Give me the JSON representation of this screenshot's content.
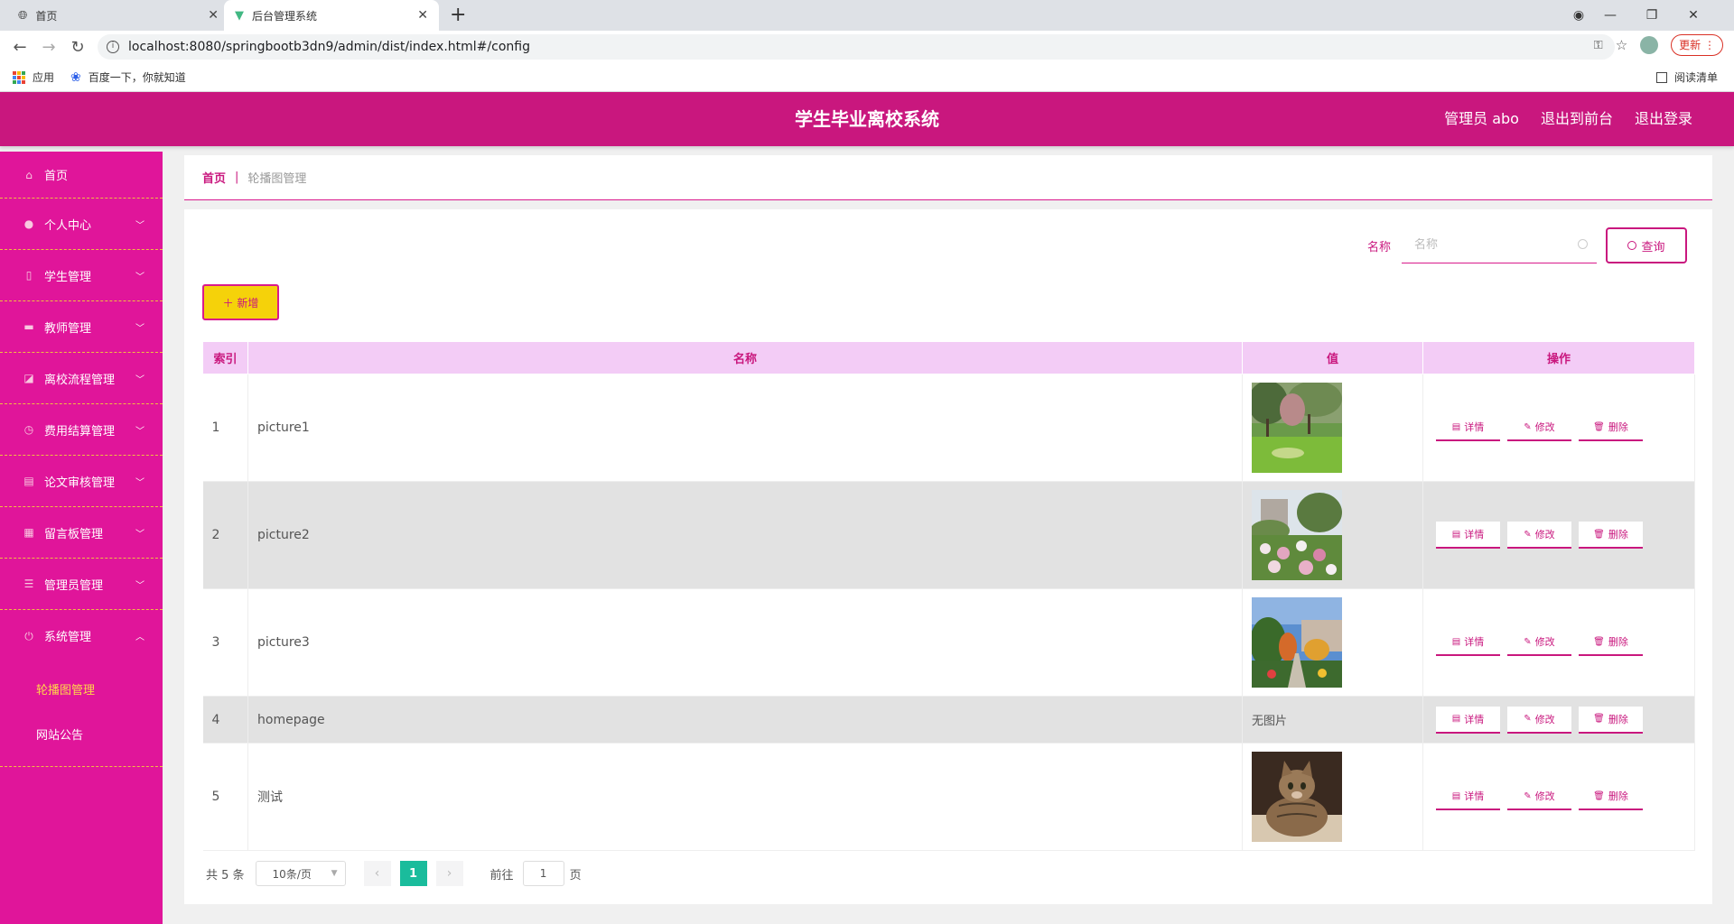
{
  "browser": {
    "tabs": [
      {
        "title": "首页",
        "icon": "globe-icon"
      },
      {
        "title": "后台管理系统",
        "icon": "vue-logo-icon"
      }
    ],
    "url": "localhost:8080/springbootb3dn9/admin/dist/index.html#/config",
    "update_label": "更新",
    "bookmarks": [
      "应用",
      "百度一下，你就知道"
    ],
    "reading_list": "阅读清单"
  },
  "header": {
    "title": "学生毕业离校系统",
    "user": "管理员 abo",
    "to_front": "退出到前台",
    "logout": "退出登录"
  },
  "sidebar": {
    "items": [
      {
        "label": "首页",
        "icon": "home-icon"
      },
      {
        "label": "个人中心",
        "icon": "user-icon"
      },
      {
        "label": "学生管理",
        "icon": "phone-icon"
      },
      {
        "label": "教师管理",
        "icon": "briefcase-icon"
      },
      {
        "label": "离校流程管理",
        "icon": "chart-icon"
      },
      {
        "label": "费用结算管理",
        "icon": "clock-icon"
      },
      {
        "label": "论文审核管理",
        "icon": "clipboard-icon"
      },
      {
        "label": "留言板管理",
        "icon": "printer-icon"
      },
      {
        "label": "管理员管理",
        "icon": "sliders-icon"
      },
      {
        "label": "系统管理",
        "icon": "power-icon"
      }
    ],
    "sub_items": [
      "轮播图管理",
      "网站公告"
    ]
  },
  "breadcrumb": {
    "home": "首页",
    "current": "轮播图管理"
  },
  "search": {
    "label": "名称",
    "placeholder": "名称",
    "button": "查询"
  },
  "add_button": "＋ 新增",
  "table": {
    "headers": [
      "索引",
      "名称",
      "值",
      "操作"
    ],
    "rows": [
      {
        "index": "1",
        "name": "picture1",
        "value_type": "image",
        "image": "park-lawn"
      },
      {
        "index": "2",
        "name": "picture2",
        "value_type": "image",
        "image": "flower-garden"
      },
      {
        "index": "3",
        "name": "picture3",
        "value_type": "image",
        "image": "autumn-path"
      },
      {
        "index": "4",
        "name": "homepage",
        "value_type": "text",
        "value": "无图片"
      },
      {
        "index": "5",
        "name": "测试",
        "value_type": "image",
        "image": "tabby-cat"
      }
    ],
    "actions": [
      "详情",
      "修改",
      "删除"
    ]
  },
  "pagination": {
    "total": "共 5 条",
    "page_size": "10条/页",
    "current_page": "1",
    "goto_label": "前往",
    "goto_value": "1",
    "page_unit": "页"
  },
  "colors": {
    "primary": "#c9177e",
    "sidebar": "#e0159a",
    "accent": "#f5d20a",
    "pager_active": "#1abc9c"
  }
}
